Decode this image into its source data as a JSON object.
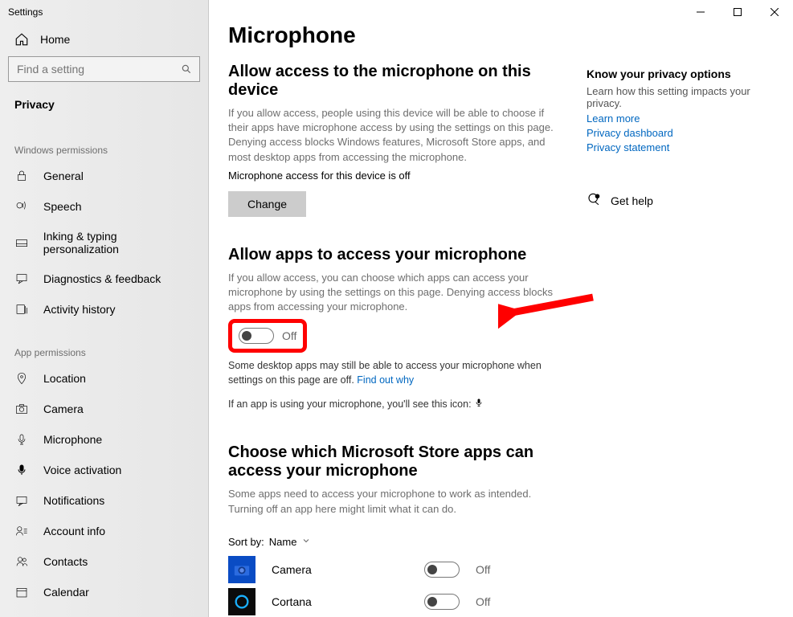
{
  "window": {
    "title": "Settings"
  },
  "sidebar": {
    "home": "Home",
    "search_placeholder": "Find a setting",
    "privacy_heading": "Privacy",
    "section_win": "Windows permissions",
    "win_items": [
      {
        "label": "General"
      },
      {
        "label": "Speech"
      },
      {
        "label": "Inking & typing personalization"
      },
      {
        "label": "Diagnostics & feedback"
      },
      {
        "label": "Activity history"
      }
    ],
    "section_app": "App permissions",
    "app_items": [
      {
        "label": "Location"
      },
      {
        "label": "Camera"
      },
      {
        "label": "Microphone"
      },
      {
        "label": "Voice activation"
      },
      {
        "label": "Notifications"
      },
      {
        "label": "Account info"
      },
      {
        "label": "Contacts"
      },
      {
        "label": "Calendar"
      }
    ]
  },
  "main": {
    "title": "Microphone",
    "s1_head": "Allow access to the microphone on this device",
    "s1_desc": "If you allow access, people using this device will be able to choose if their apps have microphone access by using the settings on this page. Denying access blocks Windows features, Microsoft Store apps, and most desktop apps from accessing the microphone.",
    "s1_status": "Microphone access for this device is off",
    "change_btn": "Change",
    "s2_head": "Allow apps to access your microphone",
    "s2_desc": "If you allow access, you can choose which apps can access your microphone by using the settings on this page. Denying access blocks apps from accessing your microphone.",
    "master_toggle": "Off",
    "s2_note_a": "Some desktop apps may still be able to access your microphone when settings on this page are off. ",
    "s2_note_link": "Find out why",
    "s2_icon_note": "If an app is using your microphone, you'll see this icon:",
    "s3_head": "Choose which Microsoft Store apps can access your microphone",
    "s3_desc": "Some apps need to access your microphone to work as intended. Turning off an app here might limit what it can do.",
    "sortby_label": "Sort by:",
    "sortby_value": "Name",
    "apps": [
      {
        "name": "Camera",
        "state": "Off"
      },
      {
        "name": "Cortana",
        "state": "Off"
      }
    ]
  },
  "right": {
    "heading": "Know your privacy options",
    "desc": "Learn how this setting impacts your privacy.",
    "learn_more": "Learn more",
    "dashboard": "Privacy dashboard",
    "statement": "Privacy statement",
    "gethelp": "Get help"
  }
}
